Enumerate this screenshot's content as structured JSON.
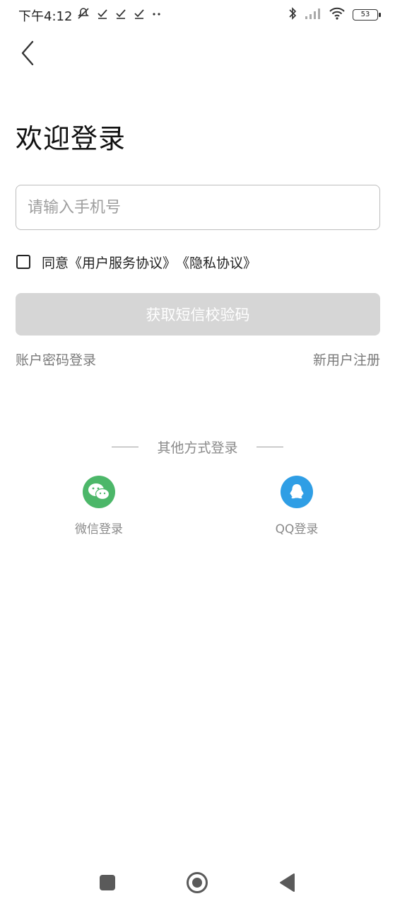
{
  "status_bar": {
    "time": "下午4:12",
    "battery_level": "53",
    "left_icons": [
      "mute-icon",
      "check-icon",
      "check-icon",
      "check-icon",
      "more-dots-icon"
    ],
    "right_icons": [
      "bluetooth-icon",
      "signal-icon",
      "wifi-icon",
      "battery-icon"
    ]
  },
  "header": {
    "back_icon": "back-arrow-icon"
  },
  "main": {
    "title": "欢迎登录",
    "phone_placeholder": "请输入手机号",
    "phone_value": "",
    "agreement": {
      "prefix": "同意",
      "user_agreement": "《用户服务协议》",
      "privacy_policy": "《隐私协议》",
      "checked": false
    },
    "get_code_label": "获取短信校验码",
    "password_login_label": "账户密码登录",
    "register_label": "新用户注册"
  },
  "other_login": {
    "label": "其他方式登录",
    "wechat_label": "微信登录",
    "qq_label": "QQ登录"
  },
  "colors": {
    "wechat": "#4cb769",
    "qq": "#2f9ee5",
    "button_disabled": "#d6d6d6"
  },
  "nav_bar": {
    "icons": [
      "recent-apps-icon",
      "home-icon",
      "back-icon"
    ]
  }
}
